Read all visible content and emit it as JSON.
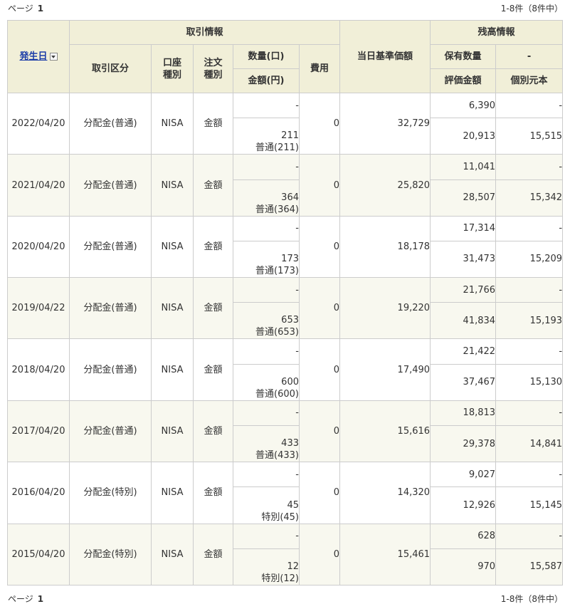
{
  "pager": {
    "page_label": "ページ",
    "page_number": "1",
    "count": "1-8件（8件中）"
  },
  "headers": {
    "date": "発生日",
    "group_trade": "取引情報",
    "trade_type": "取引区分",
    "account_type": "口座種別",
    "order_type": "注文種別",
    "quantity": "数量(口)",
    "amount": "金額(円)",
    "fee": "費用",
    "base_price": "当日基準価額",
    "group_balance": "残高情報",
    "holding_qty": "保有数量",
    "dash": "-",
    "valuation": "評価金額",
    "principal": "個別元本"
  },
  "rows": [
    {
      "date": "2022/04/20",
      "type": "分配金(普通)",
      "account": "NISA",
      "order": "金額",
      "qty": "-",
      "amount": "211",
      "amount_detail": "普通(211)",
      "fee": "0",
      "base_price": "32,729",
      "holding": "6,390",
      "holding_extra": "-",
      "valuation": "20,913",
      "principal": "15,515"
    },
    {
      "date": "2021/04/20",
      "type": "分配金(普通)",
      "account": "NISA",
      "order": "金額",
      "qty": "-",
      "amount": "364",
      "amount_detail": "普通(364)",
      "fee": "0",
      "base_price": "25,820",
      "holding": "11,041",
      "holding_extra": "-",
      "valuation": "28,507",
      "principal": "15,342"
    },
    {
      "date": "2020/04/20",
      "type": "分配金(普通)",
      "account": "NISA",
      "order": "金額",
      "qty": "-",
      "amount": "173",
      "amount_detail": "普通(173)",
      "fee": "0",
      "base_price": "18,178",
      "holding": "17,314",
      "holding_extra": "-",
      "valuation": "31,473",
      "principal": "15,209"
    },
    {
      "date": "2019/04/22",
      "type": "分配金(普通)",
      "account": "NISA",
      "order": "金額",
      "qty": "-",
      "amount": "653",
      "amount_detail": "普通(653)",
      "fee": "0",
      "base_price": "19,220",
      "holding": "21,766",
      "holding_extra": "-",
      "valuation": "41,834",
      "principal": "15,193"
    },
    {
      "date": "2018/04/20",
      "type": "分配金(普通)",
      "account": "NISA",
      "order": "金額",
      "qty": "-",
      "amount": "600",
      "amount_detail": "普通(600)",
      "fee": "0",
      "base_price": "17,490",
      "holding": "21,422",
      "holding_extra": "-",
      "valuation": "37,467",
      "principal": "15,130"
    },
    {
      "date": "2017/04/20",
      "type": "分配金(普通)",
      "account": "NISA",
      "order": "金額",
      "qty": "-",
      "amount": "433",
      "amount_detail": "普通(433)",
      "fee": "0",
      "base_price": "15,616",
      "holding": "18,813",
      "holding_extra": "-",
      "valuation": "29,378",
      "principal": "14,841"
    },
    {
      "date": "2016/04/20",
      "type": "分配金(特別)",
      "account": "NISA",
      "order": "金額",
      "qty": "-",
      "amount": "45",
      "amount_detail": "特別(45)",
      "fee": "0",
      "base_price": "14,320",
      "holding": "9,027",
      "holding_extra": "-",
      "valuation": "12,926",
      "principal": "15,145"
    },
    {
      "date": "2015/04/20",
      "type": "分配金(特別)",
      "account": "NISA",
      "order": "金額",
      "qty": "-",
      "amount": "12",
      "amount_detail": "特別(12)",
      "fee": "0",
      "base_price": "15,461",
      "holding": "628",
      "holding_extra": "-",
      "valuation": "970",
      "principal": "15,587"
    }
  ]
}
